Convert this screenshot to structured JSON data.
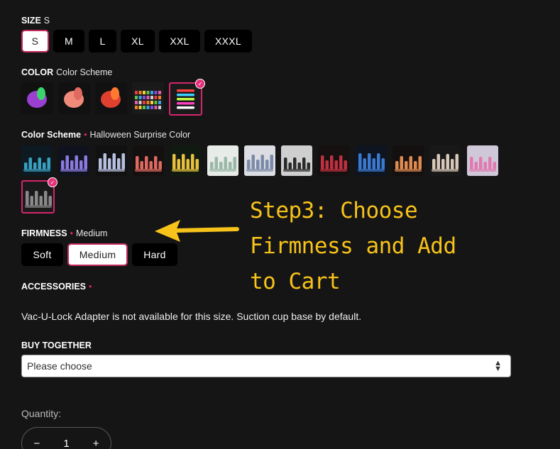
{
  "size": {
    "label": "SIZE",
    "selected_value": "S",
    "options": [
      "S",
      "M",
      "L",
      "XL",
      "XXL",
      "XXXL"
    ]
  },
  "color": {
    "label": "COLOR",
    "selected_value": "Color Scheme",
    "swatches": [
      {
        "name": "purple-green",
        "c1": "#9b3fd1",
        "c2": "#3ad46a"
      },
      {
        "name": "pink-peach",
        "c1": "#f08a7a",
        "c2": "#e06a60"
      },
      {
        "name": "red-orange",
        "c1": "#e04030",
        "c2": "#ff7a30"
      },
      {
        "name": "color-chart",
        "c1": "#333333",
        "c2": "#888888"
      },
      {
        "name": "color-scheme",
        "c1": "#1c1c1c",
        "c2": "#ff40a0"
      }
    ]
  },
  "scheme": {
    "label": "Color Scheme",
    "selected_value": "Halloween Surprise Color",
    "swatches": [
      {
        "bg": "#0d1a22",
        "fg": "#3aa0c0"
      },
      {
        "bg": "#10131e",
        "fg": "#8c7ae0"
      },
      {
        "bg": "#111111",
        "fg": "#b8c0e0"
      },
      {
        "bg": "#151010",
        "fg": "#e06a60"
      },
      {
        "bg": "#101a10",
        "fg": "#e8c040"
      },
      {
        "bg": "#e8ece8",
        "fg": "#9ab8a8"
      },
      {
        "bg": "#dcdde2",
        "fg": "#7a8aa8"
      },
      {
        "bg": "#cfcfcf",
        "fg": "#2a2a2a"
      },
      {
        "bg": "#161010",
        "fg": "#c03040"
      },
      {
        "bg": "#0e1420",
        "fg": "#3a7ad0"
      },
      {
        "bg": "#141010",
        "fg": "#e08a50"
      },
      {
        "bg": "#181818",
        "fg": "#d8c8b8"
      },
      {
        "bg": "#cfc8d8",
        "fg": "#e07ab0"
      },
      {
        "bg": "#1a1a1a",
        "fg": "#8a8a8a"
      }
    ]
  },
  "firmness": {
    "label": "FIRMNESS",
    "selected_value": "Medium",
    "options": [
      "Soft",
      "Medium",
      "Hard"
    ]
  },
  "accessories": {
    "label": "ACCESSORIES",
    "message": "Vac-U-Lock Adapter is not available for this size. Suction cup base by default."
  },
  "buy_together": {
    "label": "BUY TOGETHER",
    "placeholder": "Please choose"
  },
  "quantity": {
    "label": "Quantity:",
    "value": "1",
    "minus": "−",
    "plus": "+"
  },
  "annotation": {
    "line1": "Step3: Choose",
    "line2": "Firmness and Add",
    "line3": "to Cart",
    "color": "#f7c21a"
  },
  "accent_color": "#d4266d",
  "required_mark": "•"
}
